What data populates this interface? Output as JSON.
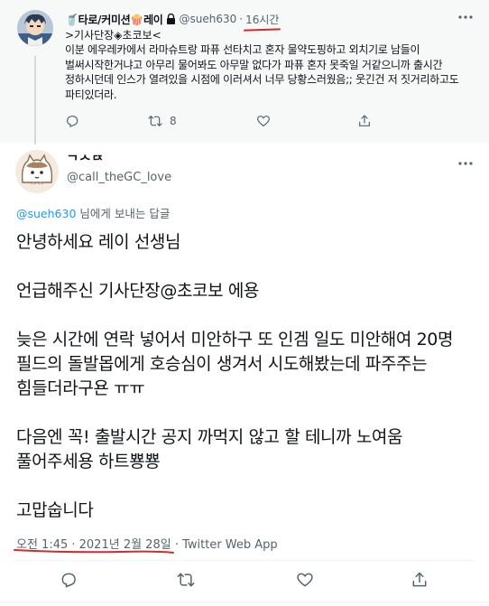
{
  "parent_tweet": {
    "display_name": "🥤타로/커미션🍿레이",
    "handle": "@sueh630",
    "separator": "·",
    "time": "16시간",
    "subtitle": ">기사단장◈초코보<",
    "body": "이분 에우레카에서 라마슈트랑 파퓨 선타치고 혼자 물약도핑하고 외치기로 남들이 벌써시작한거냐고 아무리 물어봐도 아무말 없다가 파퓨 혼자 못죽일 거같으니까 출시간 정하시던데 인스가 열려있을 시점에 이러셔서 너무 당황스러웠음;; 웃긴건 저 짓거리하고도 파티있더라.",
    "reply_count": "",
    "retweet_count": "8",
    "like_count": ""
  },
  "main_tweet": {
    "display_name": "ᄀᄉᄃᄌ",
    "handle": "@call_theGC_love",
    "reply_to_handle": "@sueh630",
    "reply_to_suffix": " 님에게 보내는 답글",
    "paragraphs": [
      "안녕하세요 레이 선생님",
      "언급해주신 기사단장@초코보 에용",
      "늦은 시간에 연락 넣어서 미안하구 또 인겜 일도 미안해여 20명 필드의 돌발몹에게 호승심이 생겨서 시도해봤는데 파주주는 힘들더라구욘 ㅠㅠ",
      "다음엔 꼭! 출발시간 공지 까먹지 않고 할 테니까 노여움 풀어주세용 하트뿅뿅",
      "고맙숩니다"
    ],
    "timestamp": "오전 1:45 · 2021년 2월 28일",
    "meta_separator": " · ",
    "client": "Twitter Web App"
  },
  "icons": {
    "reply": "reply-icon",
    "retweet": "retweet-icon",
    "like": "heart-icon",
    "share": "share-icon",
    "more": "more-icon",
    "lock": "lock-icon"
  },
  "colors": {
    "link": "#1d9bf0",
    "muted": "#536471",
    "annotation_red": "#d42a2a",
    "parent_bg": "#f7f9f9"
  }
}
